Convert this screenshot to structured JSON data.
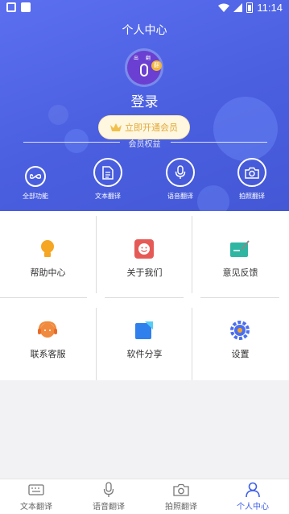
{
  "status_bar": {
    "time": "11:14",
    "battery_level": "1"
  },
  "header": {
    "title": "个人中心",
    "login_label": "登录"
  },
  "avatar": {
    "tag_left": "出",
    "tag_right": "翻",
    "coin_label": "翻"
  },
  "vip": {
    "button_label": "立即开通会员",
    "rights_label": "会员权益"
  },
  "features": [
    {
      "label": "全部功能",
      "icon": "infinity-icon"
    },
    {
      "label": "文本翻译",
      "icon": "document-icon"
    },
    {
      "label": "语音翻译",
      "icon": "microphone-icon"
    },
    {
      "label": "拍照翻译",
      "icon": "camera-icon"
    }
  ],
  "grid": [
    {
      "label": "帮助中心",
      "icon": "lightbulb-icon",
      "color": "#f5a623"
    },
    {
      "label": "关于我们",
      "icon": "smile-icon",
      "color": "#e55a57"
    },
    {
      "label": "意见反馈",
      "icon": "feedback-icon",
      "color": "#2fb6a3"
    },
    {
      "label": "联系客服",
      "icon": "headset-icon",
      "color": "#f08a3e"
    },
    {
      "label": "软件分享",
      "icon": "share-icon",
      "color": "#2f80ed"
    },
    {
      "label": "设置",
      "icon": "gear-icon",
      "color": "#4a6ef0"
    }
  ],
  "bottom_nav": [
    {
      "label": "文本翻译",
      "icon": "keyboard-icon",
      "active": false
    },
    {
      "label": "语音翻译",
      "icon": "microphone-icon",
      "active": false
    },
    {
      "label": "拍照翻译",
      "icon": "camera-icon",
      "active": false
    },
    {
      "label": "个人中心",
      "icon": "person-icon",
      "active": true
    }
  ],
  "colors": {
    "primary": "#4a5fe0",
    "accent": "#3c5ee8",
    "vip_gold": "#e0a93a"
  }
}
